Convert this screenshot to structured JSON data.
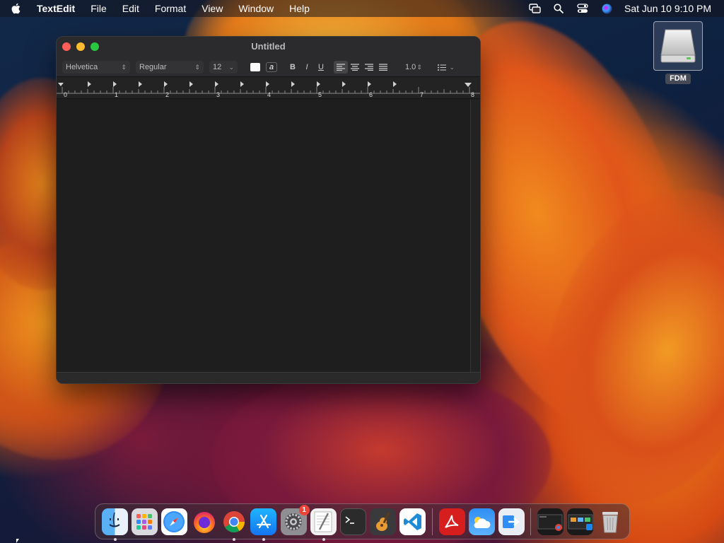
{
  "menubar": {
    "app_name": "TextEdit",
    "items": [
      "File",
      "Edit",
      "Format",
      "View",
      "Window",
      "Help"
    ],
    "clock": "Sat Jun 10  9:10 PM",
    "status_icons": [
      "screen-mirroring-icon",
      "spotlight-search-icon",
      "control-center-icon",
      "siri-icon"
    ]
  },
  "desktop": {
    "drive_label": "FDM"
  },
  "window": {
    "title": "Untitled",
    "toolbar": {
      "font_family": "Helvetica",
      "font_style": "Regular",
      "font_size": "12",
      "bold": "B",
      "italic": "I",
      "underline": "U",
      "highlight": "a",
      "line_spacing": "1.0"
    },
    "ruler_numbers": [
      "0",
      "1",
      "2",
      "3",
      "4",
      "5",
      "6",
      "7",
      "8"
    ]
  },
  "dock": {
    "apps": [
      {
        "name": "Finder",
        "running": true
      },
      {
        "name": "Launchpad",
        "running": false
      },
      {
        "name": "Safari",
        "running": false
      },
      {
        "name": "Firefox",
        "running": false
      },
      {
        "name": "Google Chrome",
        "running": true
      },
      {
        "name": "App Store",
        "running": true
      },
      {
        "name": "System Settings",
        "running": false,
        "badge": "1"
      },
      {
        "name": "TextEdit",
        "running": true
      },
      {
        "name": "Terminal",
        "running": false
      },
      {
        "name": "GarageBand",
        "running": false
      },
      {
        "name": "Visual Studio Code",
        "running": false
      },
      {
        "name": "Adobe Acrobat",
        "running": false
      },
      {
        "name": "Weather",
        "running": false
      },
      {
        "name": "Migration Assistant",
        "running": false
      },
      {
        "name": "Recent Window 1",
        "running": false
      },
      {
        "name": "Recent Window 2",
        "running": false
      },
      {
        "name": "Trash",
        "running": false
      }
    ]
  },
  "colors": {
    "window_bg": "#1e1e1e",
    "titlebar_bg": "#2b2b2d",
    "traffic_close": "#ff5f57",
    "traffic_min": "#febc2e",
    "traffic_max": "#28c840",
    "badge_red": "#f04337"
  }
}
